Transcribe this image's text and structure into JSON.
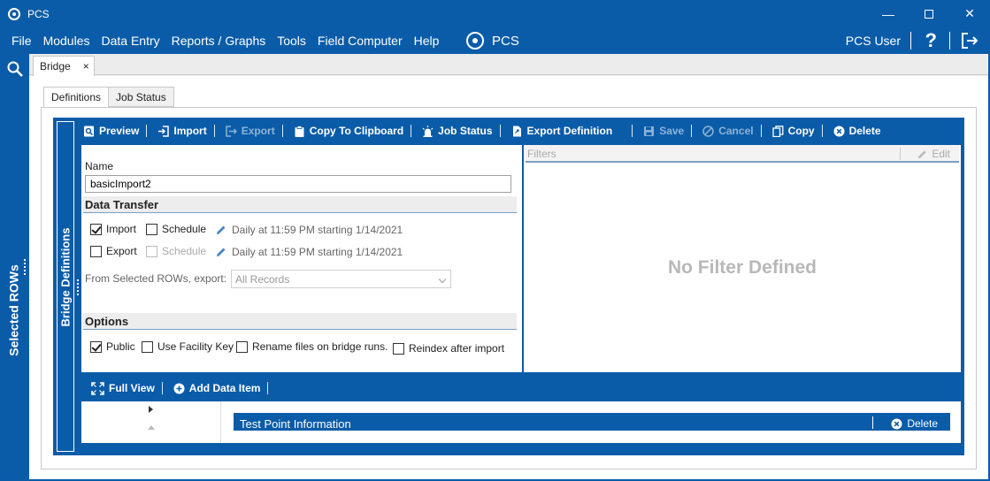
{
  "window": {
    "title": "PCS",
    "controls": [
      "minimize",
      "maximize",
      "close"
    ]
  },
  "menu": {
    "items": [
      "File",
      "Modules",
      "Data Entry",
      "Reports / Graphs",
      "Tools",
      "Field Computer",
      "Help"
    ],
    "brand": "PCS",
    "user": "PCS User",
    "help": "?"
  },
  "left_panel": {
    "label": "Selected ROWs",
    "icon": "search-icon"
  },
  "doc_tab": {
    "label": "Bridge",
    "close": "×"
  },
  "sub_tabs": [
    {
      "label": "Definitions",
      "active": true
    },
    {
      "label": "Job Status",
      "active": false
    }
  ],
  "bridge_panel": {
    "label": "Bridge Definitions"
  },
  "toolbar": {
    "preview": "Preview",
    "import": "Import",
    "export": "Export",
    "copy_clipboard": "Copy To Clipboard",
    "job_status": "Job Status",
    "export_definition": "Export Definition",
    "save": "Save",
    "cancel": "Cancel",
    "copy": "Copy",
    "delete": "Delete"
  },
  "form": {
    "name_label": "Name",
    "name_value": "basicImport2",
    "data_transfer_header": "Data Transfer",
    "import_label": "Import",
    "import_checked": true,
    "import_schedule_label": "Schedule",
    "import_schedule_text": "Daily at 11:59 PM starting 1/14/2021",
    "export_label": "Export",
    "export_checked": false,
    "export_schedule_label": "Schedule",
    "export_schedule_text": "Daily at 11:59 PM starting 1/14/2021",
    "export_from_label": "From Selected ROWs, export:",
    "export_from_value": "All Records",
    "options_header": "Options",
    "public_label": "Public",
    "public_checked": true,
    "facility_key_label": "Use Facility Key",
    "rename_label": "Rename files on bridge runs.",
    "reindex_label": "Reindex after import"
  },
  "filters": {
    "header": "Filters",
    "edit": "Edit",
    "empty_text": "No Filter Defined"
  },
  "lower_toolbar": {
    "full_view": "Full View",
    "add_data_item": "Add Data Item"
  },
  "data_items": {
    "section_title": "Test Point Information",
    "delete": "Delete"
  },
  "colors": {
    "primary": "#0a5ca8",
    "panel_bg": "#f0f0f0",
    "disabled": "#8fb3d6"
  }
}
